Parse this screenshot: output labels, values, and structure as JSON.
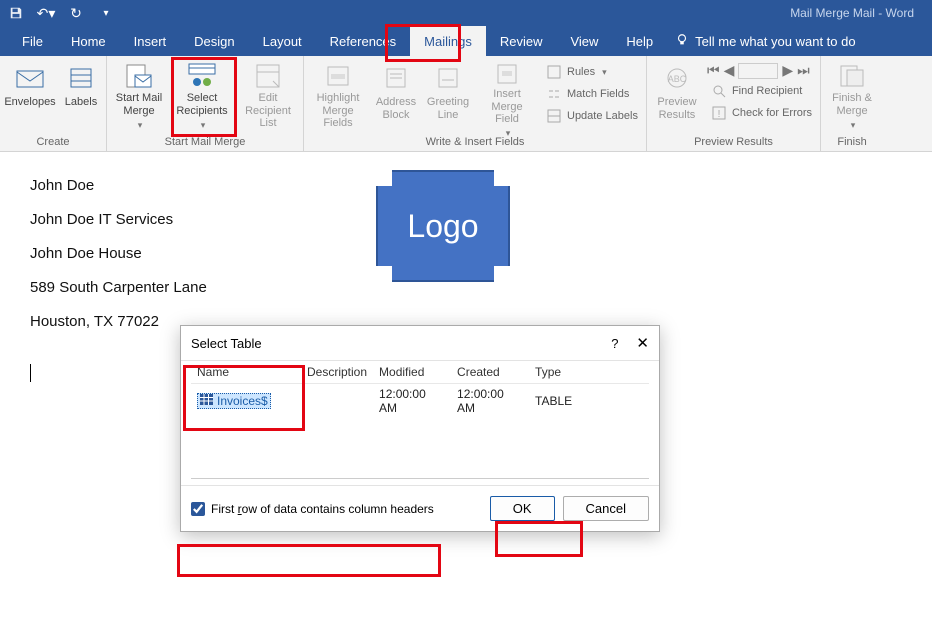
{
  "app_title": "Mail Merge Mail  -  Word",
  "menu": {
    "file": "File",
    "home": "Home",
    "insert": "Insert",
    "design": "Design",
    "layout": "Layout",
    "references": "References",
    "mailings": "Mailings",
    "review": "Review",
    "view": "View",
    "help": "Help",
    "tellme": "Tell me what you want to do"
  },
  "ribbon": {
    "create": {
      "label": "Create",
      "envelopes": "Envelopes",
      "labels": "Labels"
    },
    "start": {
      "label": "Start Mail Merge",
      "start_mail_merge": "Start Mail Merge",
      "select_recipients": "Select Recipients",
      "edit_recipient_list": "Edit Recipient List"
    },
    "write": {
      "label": "Write & Insert Fields",
      "highlight": "Highlight Merge Fields",
      "address": "Address Block",
      "greeting": "Greeting Line",
      "insert_merge": "Insert Merge Field",
      "rules": "Rules",
      "match": "Match Fields",
      "update": "Update Labels"
    },
    "preview": {
      "label": "Preview Results",
      "preview_results": "Preview Results",
      "find": "Find Recipient",
      "check": "Check for Errors"
    },
    "finish": {
      "label": "Finish",
      "finish_merge": "Finish & Merge"
    }
  },
  "document": {
    "lines": [
      "John Doe",
      "John Doe IT Services",
      "John Doe House",
      "589 South Carpenter Lane",
      "Houston, TX 77022"
    ],
    "logo": "Logo"
  },
  "dialog": {
    "title": "Select Table",
    "help": "?",
    "close": "✕",
    "columns": {
      "name": "Name",
      "description": "Description",
      "modified": "Modified",
      "created": "Created",
      "type": "Type"
    },
    "row": {
      "name": "Invoices$",
      "description": "",
      "modified": "12:00:00 AM",
      "created": "12:00:00 AM",
      "type": "TABLE"
    },
    "checkbox_label": "First row of data contains column headers",
    "ok": "OK",
    "cancel": "Cancel"
  }
}
